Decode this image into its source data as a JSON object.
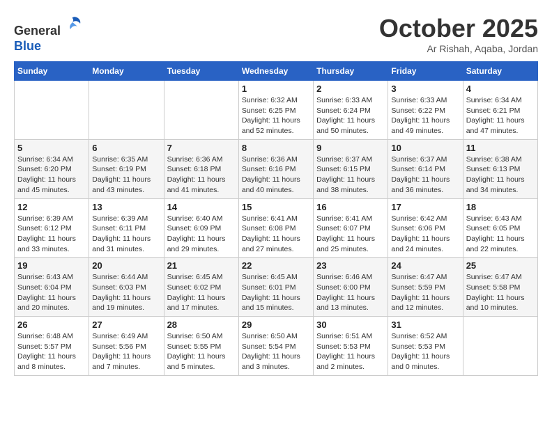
{
  "header": {
    "logo_line1": "General",
    "logo_line2": "Blue",
    "month_title": "October 2025",
    "location": "Ar Rishah, Aqaba, Jordan"
  },
  "weekdays": [
    "Sunday",
    "Monday",
    "Tuesday",
    "Wednesday",
    "Thursday",
    "Friday",
    "Saturday"
  ],
  "weeks": [
    [
      {
        "day": "",
        "info": ""
      },
      {
        "day": "",
        "info": ""
      },
      {
        "day": "",
        "info": ""
      },
      {
        "day": "1",
        "info": "Sunrise: 6:32 AM\nSunset: 6:25 PM\nDaylight: 11 hours\nand 52 minutes."
      },
      {
        "day": "2",
        "info": "Sunrise: 6:33 AM\nSunset: 6:24 PM\nDaylight: 11 hours\nand 50 minutes."
      },
      {
        "day": "3",
        "info": "Sunrise: 6:33 AM\nSunset: 6:22 PM\nDaylight: 11 hours\nand 49 minutes."
      },
      {
        "day": "4",
        "info": "Sunrise: 6:34 AM\nSunset: 6:21 PM\nDaylight: 11 hours\nand 47 minutes."
      }
    ],
    [
      {
        "day": "5",
        "info": "Sunrise: 6:34 AM\nSunset: 6:20 PM\nDaylight: 11 hours\nand 45 minutes."
      },
      {
        "day": "6",
        "info": "Sunrise: 6:35 AM\nSunset: 6:19 PM\nDaylight: 11 hours\nand 43 minutes."
      },
      {
        "day": "7",
        "info": "Sunrise: 6:36 AM\nSunset: 6:18 PM\nDaylight: 11 hours\nand 41 minutes."
      },
      {
        "day": "8",
        "info": "Sunrise: 6:36 AM\nSunset: 6:16 PM\nDaylight: 11 hours\nand 40 minutes."
      },
      {
        "day": "9",
        "info": "Sunrise: 6:37 AM\nSunset: 6:15 PM\nDaylight: 11 hours\nand 38 minutes."
      },
      {
        "day": "10",
        "info": "Sunrise: 6:37 AM\nSunset: 6:14 PM\nDaylight: 11 hours\nand 36 minutes."
      },
      {
        "day": "11",
        "info": "Sunrise: 6:38 AM\nSunset: 6:13 PM\nDaylight: 11 hours\nand 34 minutes."
      }
    ],
    [
      {
        "day": "12",
        "info": "Sunrise: 6:39 AM\nSunset: 6:12 PM\nDaylight: 11 hours\nand 33 minutes."
      },
      {
        "day": "13",
        "info": "Sunrise: 6:39 AM\nSunset: 6:11 PM\nDaylight: 11 hours\nand 31 minutes."
      },
      {
        "day": "14",
        "info": "Sunrise: 6:40 AM\nSunset: 6:09 PM\nDaylight: 11 hours\nand 29 minutes."
      },
      {
        "day": "15",
        "info": "Sunrise: 6:41 AM\nSunset: 6:08 PM\nDaylight: 11 hours\nand 27 minutes."
      },
      {
        "day": "16",
        "info": "Sunrise: 6:41 AM\nSunset: 6:07 PM\nDaylight: 11 hours\nand 25 minutes."
      },
      {
        "day": "17",
        "info": "Sunrise: 6:42 AM\nSunset: 6:06 PM\nDaylight: 11 hours\nand 24 minutes."
      },
      {
        "day": "18",
        "info": "Sunrise: 6:43 AM\nSunset: 6:05 PM\nDaylight: 11 hours\nand 22 minutes."
      }
    ],
    [
      {
        "day": "19",
        "info": "Sunrise: 6:43 AM\nSunset: 6:04 PM\nDaylight: 11 hours\nand 20 minutes."
      },
      {
        "day": "20",
        "info": "Sunrise: 6:44 AM\nSunset: 6:03 PM\nDaylight: 11 hours\nand 19 minutes."
      },
      {
        "day": "21",
        "info": "Sunrise: 6:45 AM\nSunset: 6:02 PM\nDaylight: 11 hours\nand 17 minutes."
      },
      {
        "day": "22",
        "info": "Sunrise: 6:45 AM\nSunset: 6:01 PM\nDaylight: 11 hours\nand 15 minutes."
      },
      {
        "day": "23",
        "info": "Sunrise: 6:46 AM\nSunset: 6:00 PM\nDaylight: 11 hours\nand 13 minutes."
      },
      {
        "day": "24",
        "info": "Sunrise: 6:47 AM\nSunset: 5:59 PM\nDaylight: 11 hours\nand 12 minutes."
      },
      {
        "day": "25",
        "info": "Sunrise: 6:47 AM\nSunset: 5:58 PM\nDaylight: 11 hours\nand 10 minutes."
      }
    ],
    [
      {
        "day": "26",
        "info": "Sunrise: 6:48 AM\nSunset: 5:57 PM\nDaylight: 11 hours\nand 8 minutes."
      },
      {
        "day": "27",
        "info": "Sunrise: 6:49 AM\nSunset: 5:56 PM\nDaylight: 11 hours\nand 7 minutes."
      },
      {
        "day": "28",
        "info": "Sunrise: 6:50 AM\nSunset: 5:55 PM\nDaylight: 11 hours\nand 5 minutes."
      },
      {
        "day": "29",
        "info": "Sunrise: 6:50 AM\nSunset: 5:54 PM\nDaylight: 11 hours\nand 3 minutes."
      },
      {
        "day": "30",
        "info": "Sunrise: 6:51 AM\nSunset: 5:53 PM\nDaylight: 11 hours\nand 2 minutes."
      },
      {
        "day": "31",
        "info": "Sunrise: 6:52 AM\nSunset: 5:53 PM\nDaylight: 11 hours\nand 0 minutes."
      },
      {
        "day": "",
        "info": ""
      }
    ]
  ]
}
